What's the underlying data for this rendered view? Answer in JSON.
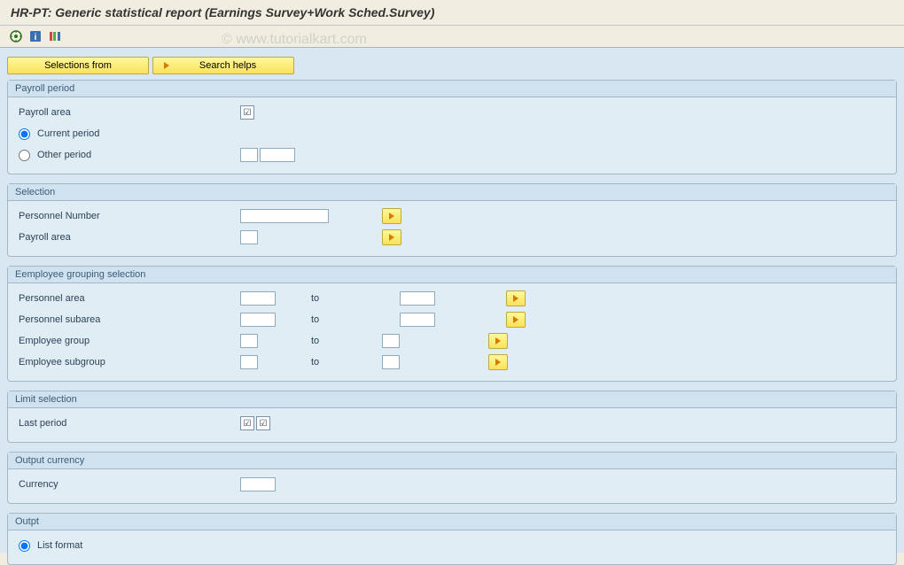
{
  "watermark": "© www.tutorialkart.com",
  "title": "HR-PT: Generic statistical report (Earnings Survey+Work Sched.Survey)",
  "toolbar_buttons": {
    "selections_from": "Selections from",
    "search_helps": "Search helps"
  },
  "groups": {
    "payroll_period": {
      "title": "Payroll period",
      "payroll_area_label": "Payroll area",
      "current_period_label": "Current period",
      "other_period_label": "Other period"
    },
    "selection": {
      "title": "Selection",
      "personnel_number_label": "Personnel Number",
      "payroll_area_label": "Payroll area"
    },
    "employee_grouping": {
      "title": "Eemployee grouping selection",
      "personnel_area_label": "Personnel area",
      "personnel_subarea_label": "Personnel subarea",
      "employee_group_label": "Employee group",
      "employee_subgroup_label": "Employee subgroup",
      "to_label": "to"
    },
    "limit_selection": {
      "title": "Limit selection",
      "last_period_label": "Last period"
    },
    "output_currency": {
      "title": "Output currency",
      "currency_label": "Currency"
    },
    "output": {
      "title": "Outpt",
      "list_format_label": "List format"
    }
  }
}
